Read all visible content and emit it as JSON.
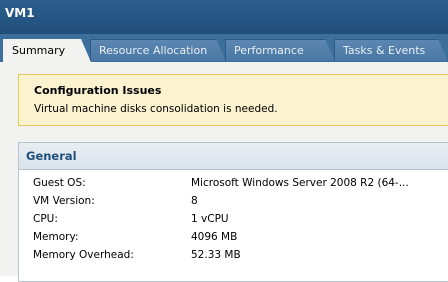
{
  "window": {
    "title": "VM1"
  },
  "tabs": [
    {
      "label": "Summary",
      "active": true
    },
    {
      "label": "Resource Allocation",
      "active": false
    },
    {
      "label": "Performance",
      "active": false
    },
    {
      "label": "Tasks & Events",
      "active": false
    }
  ],
  "config_issues": {
    "title": "Configuration Issues",
    "message": "Virtual machine disks consolidation is needed."
  },
  "general": {
    "title": "General",
    "rows": [
      {
        "key": "Guest OS:",
        "value": "Microsoft Windows Server 2008 R2 (64-..."
      },
      {
        "key": "VM Version:",
        "value": "8"
      },
      {
        "key": "CPU:",
        "value": "1 vCPU"
      },
      {
        "key": "Memory:",
        "value": "4096 MB"
      },
      {
        "key": "Memory Overhead:",
        "value": "52.33 MB"
      }
    ]
  },
  "colors": {
    "titlebar": "#2a5e8e",
    "tabstrip": "#3d6f9d",
    "warning_bg": "#fbf3d0",
    "section_title": "#1f4f7b"
  }
}
